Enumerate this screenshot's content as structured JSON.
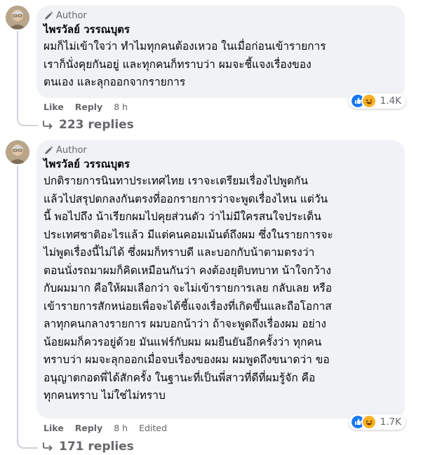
{
  "comments": [
    {
      "badge": "Author",
      "name": "ไพรวัลย์ วรรณบุตร",
      "text": "ผมก็ไม่เข้าใจว่า ทำไมทุกคนต้องเหวอ ในเมื่อก่อนเข้ารายการ\nเราก็นั่งคุยกันอยู่ และทุกคนก็ทราบว่า ผมจะชี้แจงเรื่องของ\nตนเอง และลุกออกจากรายการ",
      "like_label": "Like",
      "reply_label": "Reply",
      "time": "8 h",
      "edited": "",
      "reactions_count": "1.4K",
      "reaction_icons": [
        "like-icon",
        "haha-icon"
      ],
      "replies_label": "223 replies"
    },
    {
      "badge": "Author",
      "name": "ไพรวัลย์ วรรณบุตร",
      "text": "ปกติรายการนินทาประเทศไทย เราจะเตรียมเรื่องไปพูดกัน\nแล้วไปสรุปตกลงกันตรงที่ออกรายการว่าจะพูดเรื่องไหน แต่วัน\nนี้ พอไปถึง น้าเรียกผมไปคุยส่วนตัว ว่าไม่มีใครสนใจประเด็น\nประเทศชาติอะไรแล้ว มีแต่คนคอมเม้นต์ถึงผม ซึ่งในรายการจะ\nไม่พูดเรื่องนี้ไม่ได้ ซึ่งผมก็ทราบดี และบอกกับน้าตามตรงว่า\nตอนนั่งรถมาผมก็คิดเหมือนกันว่า คงต้องยุติบทบาท น้าใจกว้าง\nกับผมมาก คือให้ผมเลือกว่า จะไม่เข้ารายการเลย กลับเลย หรือ\nเข้ารายการสักหน่อยเพื่อจะได้ชี้แจงเรื่องที่เกิดขึ้นและถือโอกาส\nลาทุกคนกลางรายการ ผมบอกน้าว่า ถ้าจะพูดถึงเรื่องผม อย่าง\nน้อยผมก็ควรอยู่ด้วย มันแฟร์กับผม ผมยืนยันอีกครั้งว่า ทุกคน\nทราบว่า ผมจะลุกออกเมื่อจบเรื่องของผม ผมพูดถึงขนาดว่า ขอ\nอนุญาตกอดพี่ได้สักครั้ง ในฐานะที่เป็นพี่สาวที่ดีที่ผมรู้จัก คือ\nทุกคนทราบ ไม่ใช่ไม่ทราบ",
      "like_label": "Like",
      "reply_label": "Reply",
      "time": "8 h",
      "edited": "Edited",
      "reactions_count": "1.7K",
      "reaction_icons": [
        "like-icon",
        "haha-icon"
      ],
      "replies_label": "171 replies"
    }
  ],
  "colors": {
    "bubble": "#f0f2f5",
    "secondary_text": "#65676b",
    "like_blue": "#1877f2",
    "haha_yellow": "#f7b125"
  }
}
